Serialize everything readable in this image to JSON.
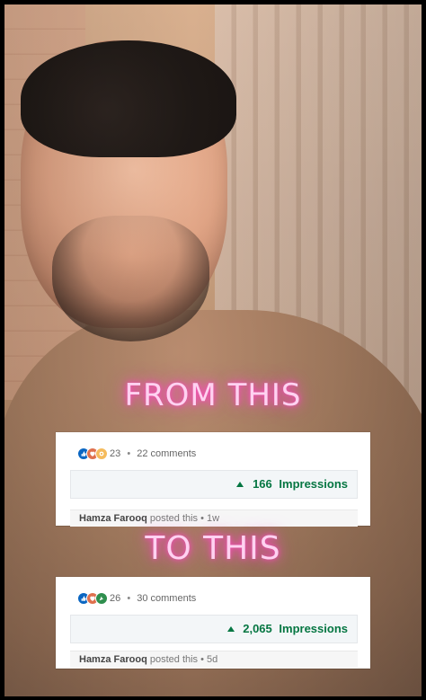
{
  "overlay": {
    "from_text": "FROM THIS",
    "to_text": "TO THIS"
  },
  "cards": [
    {
      "reactions_count": "23",
      "comments_text": "22 comments",
      "impressions_number": "166",
      "impressions_label": "Impressions",
      "posted_name": "Hamza Farooq",
      "posted_rest": "posted this • 1w",
      "reaction_icons": [
        "like-icon",
        "love-icon",
        "support-icon"
      ]
    },
    {
      "reactions_count": "26",
      "comments_text": "30 comments",
      "impressions_number": "2,065",
      "impressions_label": "Impressions",
      "posted_name": "Hamza Farooq",
      "posted_rest": "posted this • 5d",
      "reaction_icons": [
        "like-icon",
        "love-icon",
        "celebrate-icon"
      ]
    }
  ],
  "colors": {
    "neon_glow": "#ff48c4",
    "impressions_green": "#057642",
    "like_blue": "#0a66c2"
  }
}
